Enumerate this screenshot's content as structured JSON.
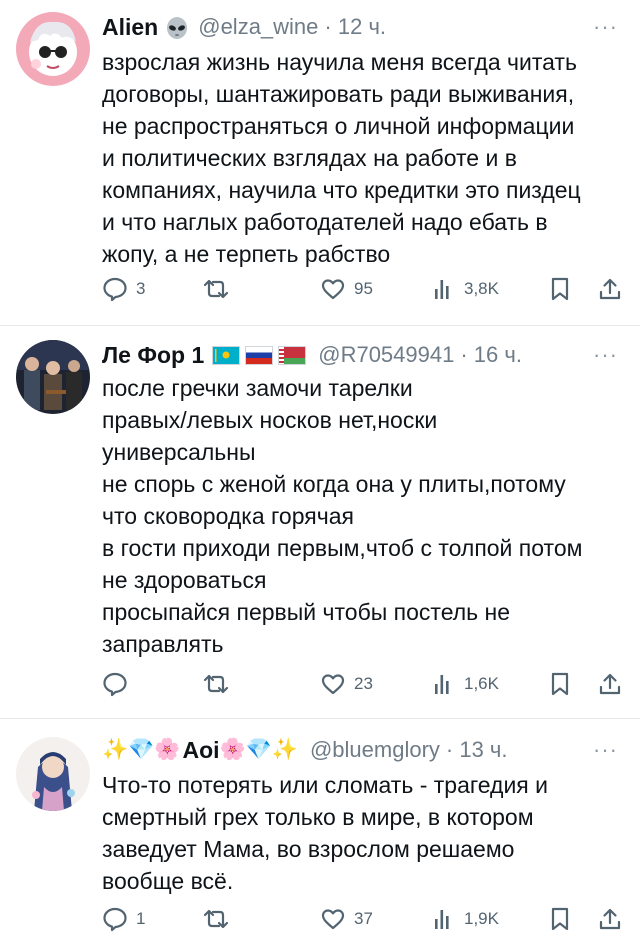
{
  "tweets": [
    {
      "name": "Alien",
      "name_badge_icon": "alien-face-icon",
      "handle": "@elza_wine",
      "time": "· 12 ч.",
      "more": "···",
      "lines": [
        "взрослая жизнь научила меня всегда читать",
        "договоры, шантажировать ради выживания,",
        "не распространяться о личной информации",
        "и политических взглядах на работе и в",
        "компаниях, научила что кредитки это пиздец",
        "и что наглых работодателей надо ебать в",
        "жопу, а не терпеть рабство"
      ],
      "stats": {
        "replies": "3",
        "retweets": "",
        "likes": "95",
        "views": "3,8K"
      }
    },
    {
      "name": "Ле Фор 1",
      "name_flags": [
        "flag-kazakhstan",
        "flag-russia",
        "flag-belarus"
      ],
      "handle": "@R70549941",
      "time": "· 16 ч.",
      "more": "···",
      "lines": [
        "после гречки замочи тарелки",
        "правых/левых носков нет,носки",
        "универсальны",
        "не спорь с женой когда она у плиты,потому",
        "что сковородка горячая",
        "в гости приходи первым,чтоб с толпой потом",
        "не здороваться",
        "просыпайся первый чтобы постель не",
        "заправлять"
      ],
      "stats": {
        "replies": "",
        "retweets": "",
        "likes": "23",
        "views": "1,6K"
      }
    },
    {
      "name_prefix": "✨💎🌸",
      "name": "Aoi",
      "name_suffix": "🌸💎✨",
      "handle": "@bluemglory",
      "time": "· 13 ч.",
      "more": "···",
      "lines": [
        "Что-то потерять или сломать - трагедия и",
        "смертный грех только в мире, в котором",
        "заведует Мама, во взрослом решаемо",
        "вообще всё."
      ],
      "stats": {
        "replies": "1",
        "retweets": "",
        "likes": "37",
        "views": "1,9K"
      }
    }
  ],
  "icons": {
    "reply": "reply-icon",
    "retweet": "retweet-icon",
    "like": "heart-icon",
    "views": "views-chart-icon",
    "bookmark": "bookmark-icon",
    "share": "share-icon"
  },
  "colors": {
    "text": "#0f1419",
    "secondary": "#536471",
    "divider": "#e6e9ec"
  }
}
